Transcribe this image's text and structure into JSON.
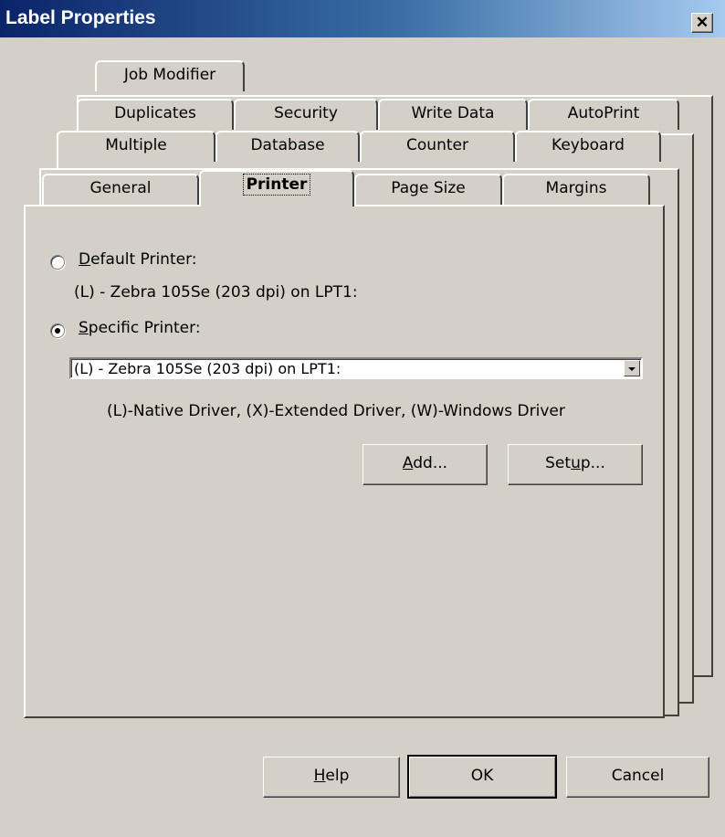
{
  "window": {
    "title": "Label Properties"
  },
  "tabs": {
    "row4": [
      "Job Modifier"
    ],
    "row3": [
      "Duplicates",
      "Security",
      "Write Data",
      "AutoPrint"
    ],
    "row2": [
      "Multiple",
      "Database",
      "Counter",
      "Keyboard"
    ],
    "row1": [
      "General",
      "Printer",
      "Page Size",
      "Margins"
    ],
    "active": "Printer"
  },
  "printer_tab": {
    "default_printer": {
      "label": "Default Printer:",
      "accel": "D",
      "rest": "efault Printer:",
      "selected": false,
      "value": "(L) - Zebra 105Se (203 dpi) on LPT1:"
    },
    "specific_printer": {
      "label": "Specific Printer:",
      "accel": "S",
      "rest": "pecific Printer:",
      "selected": true
    },
    "printer_select": {
      "value": "(L) - Zebra 105Se (203 dpi) on LPT1:"
    },
    "driver_legend": "(L)-Native Driver, (X)-Extended Driver, (W)-Windows Driver",
    "add_button": {
      "label": "Add...",
      "accel": "A",
      "rest": "dd..."
    },
    "setup_button": {
      "label": "Setup...",
      "pre": "Set",
      "accel": "u",
      "rest": "p..."
    }
  },
  "dialog_buttons": {
    "help": {
      "label": "Help",
      "accel": "H",
      "rest": "elp"
    },
    "ok": {
      "label": "OK"
    },
    "cancel": {
      "label": "Cancel"
    }
  }
}
